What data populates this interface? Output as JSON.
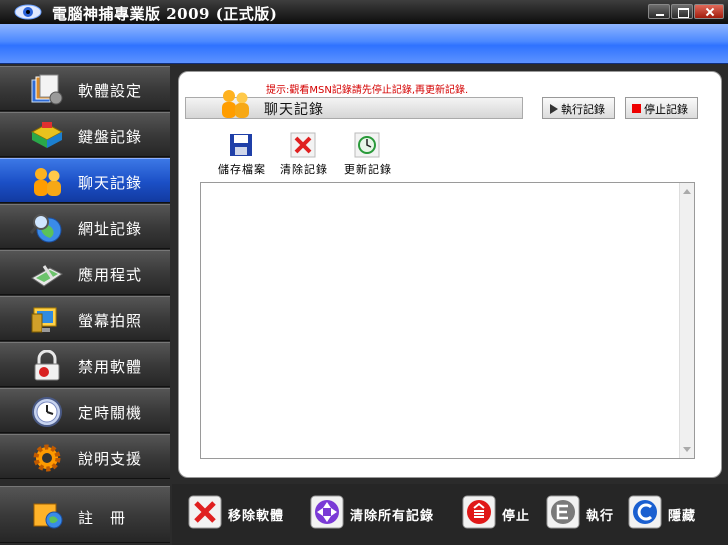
{
  "window": {
    "title": "電腦神捕專業版 2009 (正式版)"
  },
  "sidebar": {
    "items": [
      {
        "label": "軟體設定",
        "icon": "software-settings-icon",
        "active": false
      },
      {
        "label": "鍵盤記錄",
        "icon": "keyboard-log-icon",
        "active": false
      },
      {
        "label": "聊天記錄",
        "icon": "chat-log-icon",
        "active": true
      },
      {
        "label": "網址記錄",
        "icon": "url-log-icon",
        "active": false
      },
      {
        "label": "應用程式",
        "icon": "applications-icon",
        "active": false
      },
      {
        "label": "螢幕拍照",
        "icon": "screenshot-icon",
        "active": false
      },
      {
        "label": "禁用軟體",
        "icon": "lock-icon",
        "active": false
      },
      {
        "label": "定時關機",
        "icon": "clock-icon",
        "active": false
      },
      {
        "label": "說明支援",
        "icon": "gear-icon",
        "active": false
      },
      {
        "label": "註　冊",
        "icon": "register-icon",
        "active": false
      }
    ]
  },
  "content": {
    "hint": "提示:觀看MSN記錄請先停止記錄,再更新記錄.",
    "title": "聊天記錄",
    "run_label": "執行記錄",
    "stop_label": "停止記錄",
    "tools": {
      "save": "儲存檔案",
      "clear": "清除記錄",
      "refresh": "更新記錄"
    },
    "log_text": ""
  },
  "bottom": {
    "remove": "移除軟體",
    "clear_all": "清除所有記錄",
    "stop": "停止",
    "run": "執行",
    "hide": "隱藏"
  },
  "colors": {
    "banner": "#4b88ff",
    "active_nav": "#1b4fc6",
    "hint": "#d40000"
  }
}
